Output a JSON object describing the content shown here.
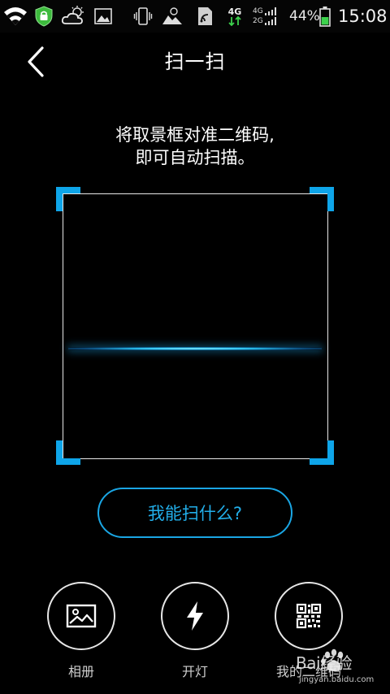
{
  "status_bar": {
    "network_label": "4G",
    "network_4g_small": "4G",
    "network_2g_small": "2G",
    "battery_percent": "44%",
    "battery_level": 0.44,
    "time": "15:08"
  },
  "header": {
    "title": "扫一扫"
  },
  "scan": {
    "hint_line1": "将取景框对准二维码,",
    "hint_line2": "即可自动扫描。"
  },
  "help_button": {
    "label": "我能扫什么?"
  },
  "actions": [
    {
      "label": "相册",
      "icon": "image-icon"
    },
    {
      "label": "开灯",
      "icon": "flash-icon"
    },
    {
      "label": "我的二维码",
      "icon": "qr-code-icon"
    }
  ],
  "watermark": {
    "text": "Bai经验",
    "subtext": "jingyan.baidu.com"
  },
  "colors": {
    "accent": "#1aa6e4",
    "corner": "#0ea5e9",
    "background": "#000000"
  }
}
